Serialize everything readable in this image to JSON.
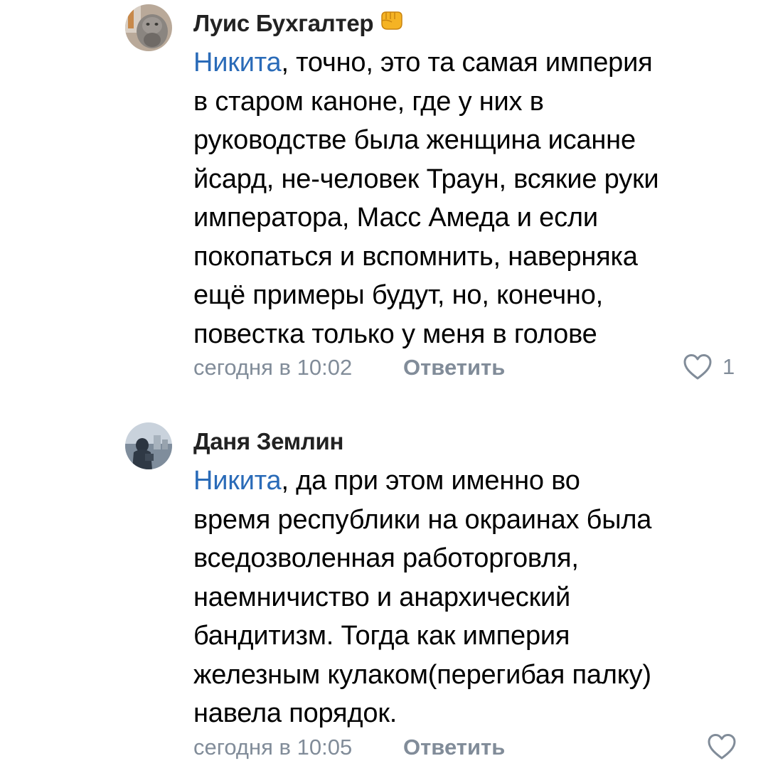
{
  "comments": [
    {
      "author": "Луис Бухгалтер",
      "author_badge_icon": "fist-emoji-icon",
      "mention": "Никита",
      "lines": [
        ", точно, это та самая империя",
        "в старом каноне, где у них в",
        "руководстве была женщина исанне",
        "йсард, не-человек Траун, всякие руки",
        "императора, Масс Амеда и если",
        "покопаться и вспомнить, наверняка",
        "ещё примеры будут, но, конечно,",
        "повестка только у меня в голове"
      ],
      "time": "сегодня в 10:02",
      "reply_label": "Ответить",
      "like_count": "1"
    },
    {
      "author": "Даня Землин",
      "mention": "Никита",
      "lines": [
        ", да при этом именно во",
        "время республики на окраинах была",
        "вседозволенная работорговля,",
        "наемничиство и анархический",
        "бандитизм. Тогда как империя",
        "железным кулаком(перегибая палку)",
        "навела порядок."
      ],
      "time": "сегодня в 10:05",
      "reply_label": "Ответить",
      "like_count": ""
    }
  ],
  "colors": {
    "mention": "#2a6bb8",
    "meta": "#818c99",
    "text": "#000000"
  }
}
